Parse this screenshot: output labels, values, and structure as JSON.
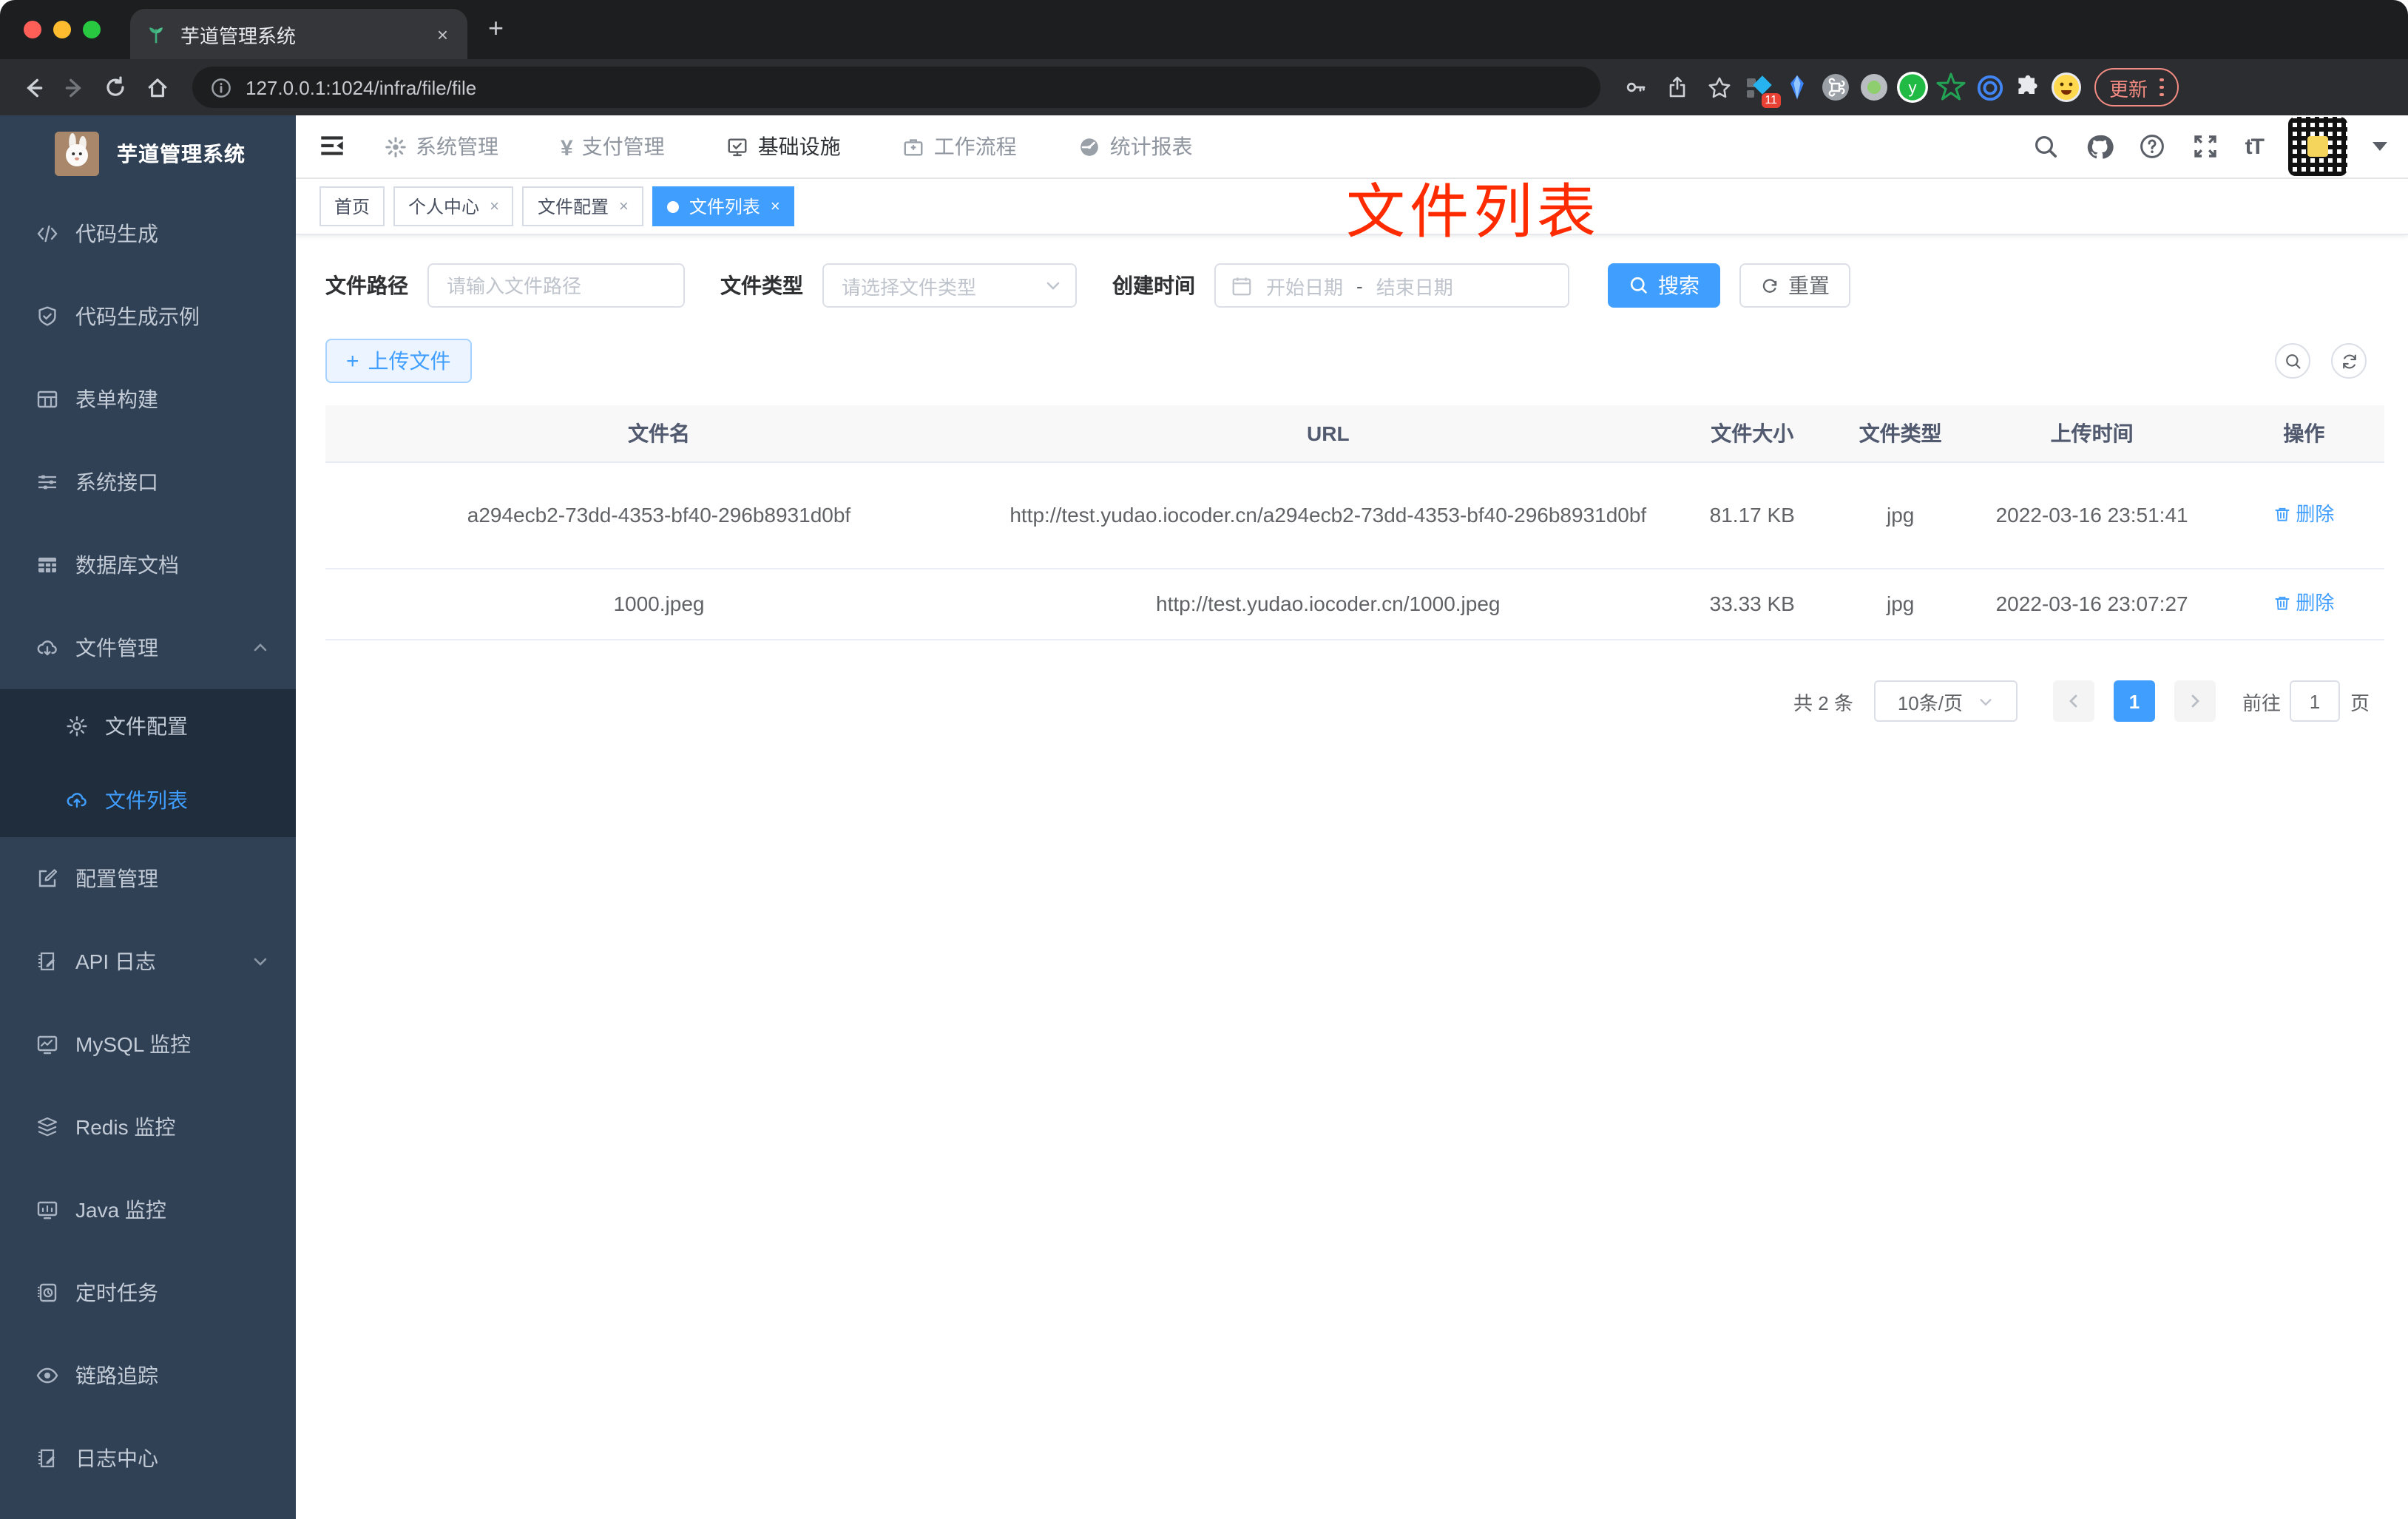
{
  "browser": {
    "tab_title": "芋道管理系统",
    "url": "127.0.0.1:1024/infra/file/file",
    "update_label": "更新",
    "extension_badge": "11",
    "ext_y_letter": "y"
  },
  "glyphs": {
    "close": "×",
    "plus": "+",
    "yen": "¥",
    "font_size": "tT"
  },
  "sidebar": {
    "title": "芋道管理系统",
    "items": [
      {
        "label": "代码生成"
      },
      {
        "label": "代码生成示例"
      },
      {
        "label": "表单构建"
      },
      {
        "label": "系统接口"
      },
      {
        "label": "数据库文档"
      },
      {
        "label": "文件管理",
        "children": [
          {
            "label": "文件配置"
          },
          {
            "label": "文件列表"
          }
        ]
      },
      {
        "label": "配置管理"
      },
      {
        "label": "API 日志"
      },
      {
        "label": "MySQL 监控"
      },
      {
        "label": "Redis 监控"
      },
      {
        "label": "Java 监控"
      },
      {
        "label": "定时任务"
      },
      {
        "label": "链路追踪"
      },
      {
        "label": "日志中心"
      }
    ]
  },
  "topnav": {
    "items": [
      "系统管理",
      "支付管理",
      "基础设施",
      "工作流程",
      "统计报表"
    ]
  },
  "tags": [
    {
      "label": "首页"
    },
    {
      "label": "个人中心"
    },
    {
      "label": "文件配置"
    },
    {
      "label": "文件列表"
    }
  ],
  "annotation": {
    "text": "文件列表"
  },
  "filters": {
    "path_label": "文件路径",
    "path_placeholder": "请输入文件路径",
    "type_label": "文件类型",
    "type_placeholder": "请选择文件类型",
    "time_label": "创建时间",
    "start_placeholder": "开始日期",
    "range_separator": "-",
    "end_placeholder": "结束日期",
    "search_label": "搜索",
    "reset_label": "重置"
  },
  "toolbar": {
    "upload_label": "上传文件"
  },
  "table": {
    "columns": [
      "文件名",
      "URL",
      "文件大小",
      "文件类型",
      "上传时间",
      "操作"
    ],
    "rows": [
      {
        "name": "a294ecb2-73dd-4353-bf40-296b8931d0bf",
        "url": "http://test.yudao.iocoder.cn/a294ecb2-73dd-4353-bf40-296b8931d0bf",
        "size": "81.17 KB",
        "type": "jpg",
        "time": "2022-03-16 23:51:41",
        "action": "删除"
      },
      {
        "name": "1000.jpeg",
        "url": "http://test.yudao.iocoder.cn/1000.jpeg",
        "size": "33.33 KB",
        "type": "jpg",
        "time": "2022-03-16 23:07:27",
        "action": "删除"
      }
    ]
  },
  "pagination": {
    "total": "共 2 条",
    "page_size": "10条/页",
    "current_page": "1",
    "goto_label": "前往",
    "goto_value": "1",
    "page_unit": "页"
  },
  "colors": {
    "accent": "#409eff",
    "annotation_red": "#fe2b00",
    "sidebar_bg": "#304156",
    "submenu_bg": "#1f2d3d",
    "chrome_bg": "#2b2d30",
    "update_pink": "#f28b82"
  }
}
